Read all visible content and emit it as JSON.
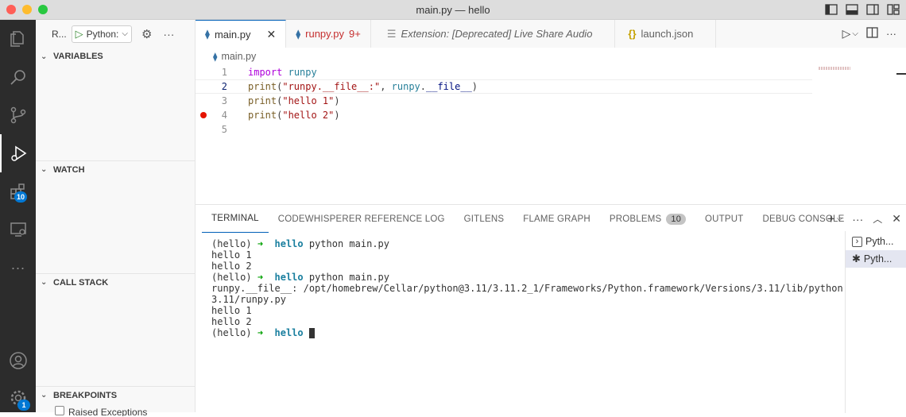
{
  "window": {
    "title": "main.py — hello"
  },
  "activity_bar": {
    "extensions_badge": "10",
    "accounts_badge": "1",
    "icons": [
      "files-icon",
      "search-icon",
      "source-control-icon",
      "run-debug-icon",
      "extensions-icon",
      "remote-explorer-icon",
      "more-icon",
      "accounts-icon",
      "manage-gear-icon"
    ]
  },
  "sidebar": {
    "run_label": "R...",
    "config_select": "Python:",
    "sections": {
      "variables": "VARIABLES",
      "watch": "WATCH",
      "call_stack": "CALL STACK",
      "breakpoints": "BREAKPOINTS"
    },
    "breakpoint_item": "Raised Exceptions"
  },
  "tabs": [
    {
      "label": "main.py",
      "active": true
    },
    {
      "label": "runpy.py",
      "badge": "9+"
    },
    {
      "label": "Extension: [Deprecated] Live Share Audio"
    },
    {
      "label": "launch.json"
    }
  ],
  "breadcrumb": {
    "file": "main.py"
  },
  "editor": {
    "line_numbers": [
      "1",
      "2",
      "3",
      "4",
      "5"
    ],
    "current_line": 2,
    "breakpoint_line": 4
  },
  "panel": {
    "tabs": [
      "TERMINAL",
      "CODEWHISPERER REFERENCE LOG",
      "GITLENS",
      "FLAME GRAPH",
      "PROBLEMS",
      "OUTPUT",
      "DEBUG CONSOLE"
    ],
    "problems_count": "10",
    "terminal_lines": {
      "l1_env": "(hello)",
      "l1_dir": "hello",
      "l1_cmd": " python main.py",
      "l2": "hello 1",
      "l3": "hello 2",
      "l4_env": "(hello)",
      "l4_dir": "hello",
      "l4_cmd": " python main.py",
      "l5": "runpy.__file__: /opt/homebrew/Cellar/python@3.11/3.11.2_1/Frameworks/Python.framework/Versions/3.11/lib/python",
      "l6": "3.11/runpy.py",
      "l7": "hello 1",
      "l8": "hello 2",
      "l9_env": "(hello)",
      "l9_dir": "hello"
    },
    "terminal_list": [
      "Pyth...",
      "Pyth..."
    ]
  },
  "colors": {
    "accent": "#005fb8",
    "badge": "#0078d4",
    "breakpoint": "#e51400"
  }
}
